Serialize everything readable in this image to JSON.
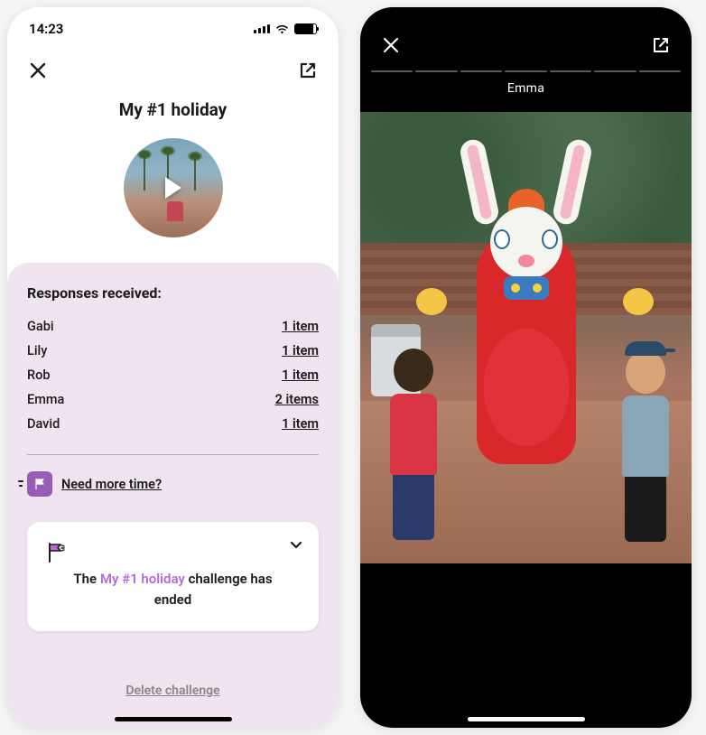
{
  "status": {
    "time": "14:23"
  },
  "left": {
    "title": "My #1 holiday",
    "responses_header": "Responses received:",
    "responses": [
      {
        "name": "Gabi",
        "count_label": "1 item"
      },
      {
        "name": "Lily",
        "count_label": "1 item"
      },
      {
        "name": "Rob",
        "count_label": "1 item"
      },
      {
        "name": "Emma",
        "count_label": "2 items"
      },
      {
        "name": "David",
        "count_label": "1 item"
      }
    ],
    "need_more_time": "Need more time?",
    "ended_prefix": "The ",
    "ended_name": "My #1 holiday",
    "ended_suffix": " challenge has ended",
    "delete_label": "Delete challenge"
  },
  "right": {
    "viewer_name": "Emma",
    "segment_count": 7
  },
  "colors": {
    "accent_purple": "#b868d8",
    "card_purple": "#f0e4f0"
  }
}
